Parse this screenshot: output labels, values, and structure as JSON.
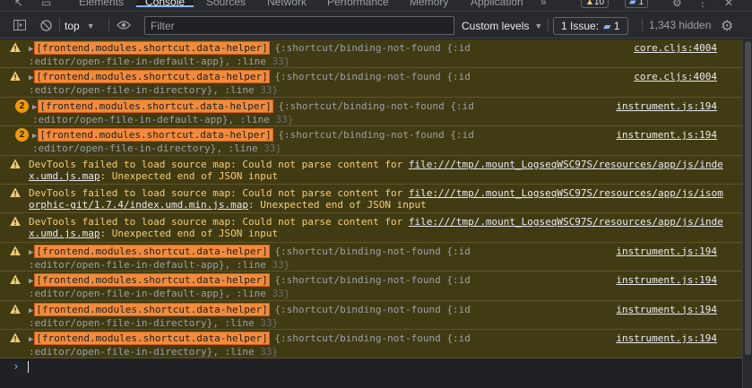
{
  "tabs": {
    "items": [
      "Elements",
      "Console",
      "Sources",
      "Network",
      "Performance",
      "Memory",
      "Application"
    ],
    "active": "Console",
    "overflow": "»",
    "warning_count": "10",
    "message_count": "1",
    "close": "✕"
  },
  "toolbar": {
    "context": "top",
    "filter_placeholder": "Filter",
    "levels": "Custom levels",
    "issues_label": "1 Issue:",
    "issues_count": "1",
    "hidden": "1,343 hidden"
  },
  "messages": [
    {
      "type": "warn",
      "count": "",
      "tag": "[frontend.modules.shortcut.data-helper]",
      "obj": "{:shortcut/binding-not-found {:id",
      "cont": ":editor/open-file-in-default-app}",
      "line_kw": ", :line ",
      "line": "33}",
      "source": "core.cljs:4004"
    },
    {
      "type": "warn",
      "count": "",
      "tag": "[frontend.modules.shortcut.data-helper]",
      "obj": "{:shortcut/binding-not-found {:id",
      "cont": ":editor/open-file-in-directory}",
      "line_kw": ", :line ",
      "line": "33}",
      "source": "core.cljs:4004"
    },
    {
      "type": "count",
      "count": "2",
      "tag": "[frontend.modules.shortcut.data-helper]",
      "obj": "{:shortcut/binding-not-found {:id",
      "cont": ":editor/open-file-in-default-app}",
      "line_kw": ", :line ",
      "line": "33}",
      "source": "instrument.js:194"
    },
    {
      "type": "count",
      "count": "2",
      "tag": "[frontend.modules.shortcut.data-helper]",
      "obj": "{:shortcut/binding-not-found {:id",
      "cont": ":editor/open-file-in-directory}",
      "line_kw": ", :line ",
      "line": "33}",
      "source": "instrument.js:194"
    },
    {
      "type": "devtools",
      "pre": "DevTools failed to load source map: Could not parse content for ",
      "link1": "file:///tmp/.mount_LogseqWSC97S/resources/app/js/inde",
      "link2": "x.umd.js.map",
      "post": ": Unexpected end of JSON input"
    },
    {
      "type": "devtools",
      "pre": "DevTools failed to load source map: Could not parse content for ",
      "link1": "file:///tmp/.mount_LogseqWSC97S/resources/app/js/isom",
      "link2": "orphic-git/1.7.4/index.umd.min.js.map",
      "post": ": Unexpected end of JSON input"
    },
    {
      "type": "devtools",
      "pre": "DevTools failed to load source map: Could not parse content for ",
      "link1": "file:///tmp/.mount_LogseqWSC97S/resources/app/js/inde",
      "link2": "x.umd.js.map",
      "post": ": Unexpected end of JSON input"
    },
    {
      "type": "warn",
      "count": "",
      "tag": "[frontend.modules.shortcut.data-helper]",
      "obj": "{:shortcut/binding-not-found {:id",
      "cont": ":editor/open-file-in-default-app}",
      "line_kw": ", :line ",
      "line": "33}",
      "source": "instrument.js:194"
    },
    {
      "type": "warn",
      "count": "",
      "tag": "[frontend.modules.shortcut.data-helper]",
      "obj": "{:shortcut/binding-not-found {:id",
      "cont": ":editor/open-file-in-default-app}",
      "line_kw": ", :line ",
      "line": "33}",
      "source": "instrument.js:194"
    },
    {
      "type": "warn",
      "count": "",
      "tag": "[frontend.modules.shortcut.data-helper]",
      "obj": "{:shortcut/binding-not-found {:id",
      "cont": ":editor/open-file-in-directory}",
      "line_kw": ", :line ",
      "line": "33}",
      "source": "instrument.js:194"
    },
    {
      "type": "warn",
      "count": "",
      "tag": "[frontend.modules.shortcut.data-helper]",
      "obj": "{:shortcut/binding-not-found {:id",
      "cont": ":editor/open-file-in-directory}",
      "line_kw": ", :line ",
      "line": "33}",
      "source": "instrument.js:194"
    }
  ],
  "prompt": "›",
  "colors": {
    "warning_bg": "#413b14",
    "warning_text": "#f6cc76",
    "tag_bg": "#f28b3b",
    "accent": "#8ab4f8"
  }
}
